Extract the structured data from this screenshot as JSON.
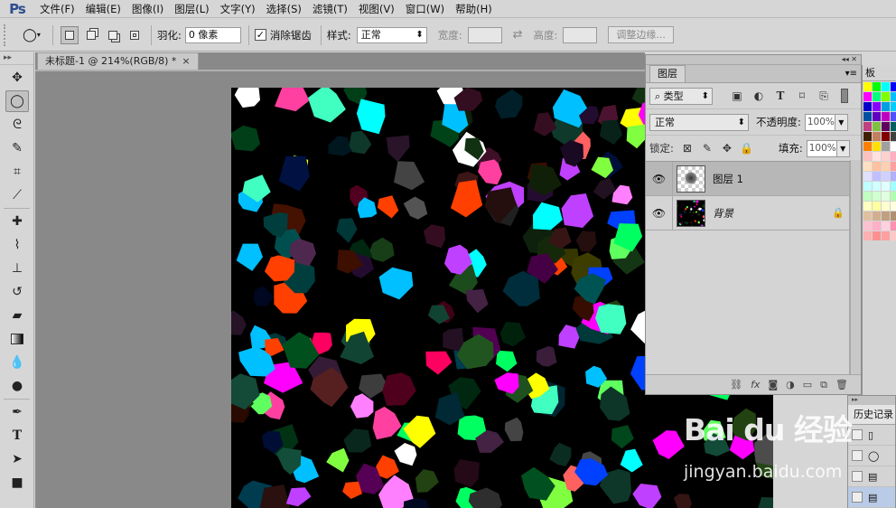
{
  "app": {
    "logo": "Ps"
  },
  "menu": [
    "文件(F)",
    "编辑(E)",
    "图像(I)",
    "图层(L)",
    "文字(Y)",
    "选择(S)",
    "滤镜(T)",
    "视图(V)",
    "窗口(W)",
    "帮助(H)"
  ],
  "options": {
    "feather_label": "羽化:",
    "feather_value": "0 像素",
    "antialias_label": "消除锯齿",
    "antialias_checked": true,
    "style_label": "样式:",
    "style_value": "正常",
    "width_label": "宽度:",
    "height_label": "高度:",
    "refine_edge": "调整边缘..."
  },
  "document": {
    "tab_title": "未标题-1 @ 214%(RGB/8) *",
    "close": "×"
  },
  "layers_panel": {
    "tab": "图层",
    "filter_kind": "类型",
    "blend_mode": "正常",
    "opacity_label": "不透明度:",
    "opacity_value": "100%",
    "lock_label": "锁定:",
    "fill_label": "填充:",
    "fill_value": "100%",
    "layers": [
      {
        "name": "图层 1",
        "selected": true,
        "locked": false,
        "italic": false
      },
      {
        "name": "背景",
        "selected": false,
        "locked": true,
        "italic": true
      }
    ]
  },
  "swatches_panel": {
    "tab": "板"
  },
  "history_panel": {
    "tab": "历史记录"
  },
  "watermark": {
    "brand": "Bai du 经验",
    "url": "jingyan.baidu.com"
  },
  "swatch_colors": [
    "#ffff00",
    "#00ff00",
    "#00ffff",
    "#0000ff",
    "#ff00ff",
    "#00ff7f",
    "#7fff00",
    "#00bfff",
    "#0000cc",
    "#8a00ff",
    "#00a0e0",
    "#00ccff",
    "#0050a0",
    "#6000c0",
    "#c000c0",
    "#5050ff",
    "#c04080",
    "#80c040",
    "#600060",
    "#006060",
    "#402000",
    "#c08060",
    "#800000",
    "#404040",
    "#ff8000",
    "#ffe000",
    "#a0a0a0",
    "#ffffff",
    "#ffc0c0",
    "#ffe0e0",
    "#ffd0d0",
    "#ffb0c0",
    "#ffe0c0",
    "#ffc0a0",
    "#ffd0b0",
    "#ffa0a0",
    "#e0e0ff",
    "#c0c0ff",
    "#d0d0ff",
    "#b0b0ff",
    "#c0ffff",
    "#d0ffff",
    "#e0ffff",
    "#a0ffff",
    "#c0ffc0",
    "#d0ffd0",
    "#e0ffe0",
    "#b0ffb0",
    "#ffffc0",
    "#ffffa0",
    "#ffffd0",
    "#ffffe0",
    "#e0c0a0",
    "#d0b090",
    "#c0a080",
    "#b09070",
    "#ffc0d0",
    "#ffb0c8",
    "#ffd0e0",
    "#ff90b0",
    "#ffb0b0",
    "#ff9090",
    "#ffa0a0",
    "#ffc8c8"
  ],
  "canvas_blobs": [
    "#ff00ff",
    "#00ffff",
    "#00ff60",
    "#ff0060",
    "#ff4000",
    "#80ff40",
    "#ffff00",
    "#ffffff",
    "#0040ff",
    "#ff80ff",
    "#40ffc0",
    "#c040ff",
    "#ff6060",
    "#60ff60",
    "#00c0ff",
    "#ff40a0"
  ]
}
